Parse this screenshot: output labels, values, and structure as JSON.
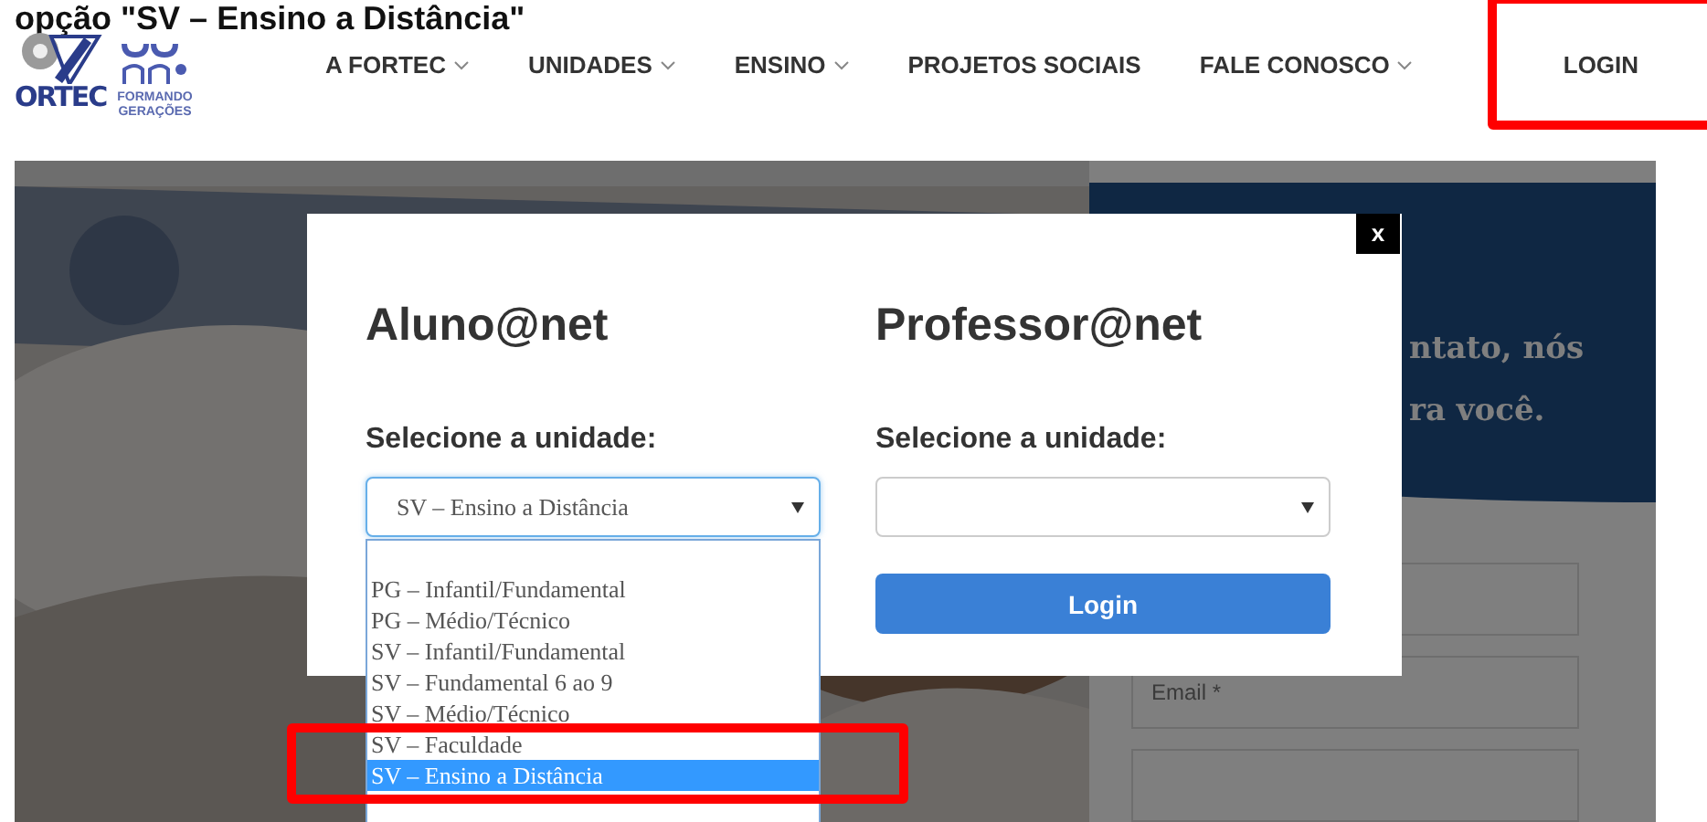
{
  "caption": "opção \"SV – Ensino a Distância\"",
  "logo": {
    "brand": "ORTEC",
    "tagline": [
      "FORMANDO",
      "GERAÇÕES"
    ]
  },
  "nav": {
    "items": [
      {
        "label": "A FORTEC",
        "has_dropdown": true,
        "highlighted": false
      },
      {
        "label": "UNIDADES",
        "has_dropdown": true,
        "highlighted": false
      },
      {
        "label": "ENSINO",
        "has_dropdown": true,
        "highlighted": false
      },
      {
        "label": "PROJETOS SOCIAIS",
        "has_dropdown": false,
        "highlighted": false
      },
      {
        "label": "FALE CONOSCO",
        "has_dropdown": true,
        "highlighted": false
      },
      {
        "label": "LOGIN",
        "has_dropdown": false,
        "highlighted": true
      }
    ]
  },
  "backdrop": {
    "banner_lines": [
      "ntato, nós",
      "ra você."
    ],
    "fields": [
      {
        "kind": "blank"
      },
      {
        "kind": "text",
        "placeholder": "Email *"
      },
      {
        "kind": "blank"
      }
    ]
  },
  "modal": {
    "close_label": "x",
    "columns": [
      {
        "title": "Aluno@net",
        "label": "Selecione a unidade:",
        "select": {
          "value": "SV – Ensino a Distância",
          "open": true,
          "options": [
            {
              "label": "PG – Infantil/Fundamental",
              "selected": false,
              "highlighted": false
            },
            {
              "label": "PG – Médio/Técnico",
              "selected": false,
              "highlighted": false
            },
            {
              "label": "SV – Infantil/Fundamental",
              "selected": false,
              "highlighted": false
            },
            {
              "label": "SV – Fundamental 6 ao 9",
              "selected": false,
              "highlighted": false
            },
            {
              "label": "SV – Médio/Técnico",
              "selected": false,
              "highlighted": false
            },
            {
              "label": "SV – Faculdade",
              "selected": false,
              "highlighted": true
            },
            {
              "label": "SV – Ensino a Distância",
              "selected": true,
              "highlighted": true
            }
          ]
        }
      },
      {
        "title": "Professor@net",
        "label": "Selecione a unidade:",
        "select": {
          "open": false
        },
        "button": "Login"
      }
    ]
  }
}
